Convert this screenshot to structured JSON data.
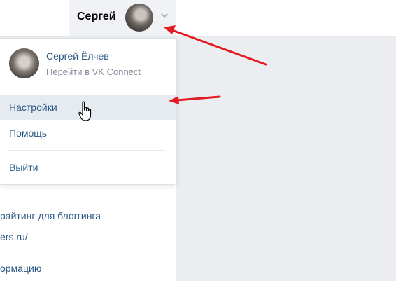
{
  "header": {
    "user_short_name": "Сергей"
  },
  "dropdown": {
    "full_name": "Сергей Ёлчев",
    "subtitle": "Перейти в VK Connect",
    "items": [
      {
        "label": "Настройки"
      },
      {
        "label": "Помощь"
      },
      {
        "label": "Выйти"
      }
    ]
  },
  "background_content": {
    "lines": [
      "райтинг для блоггинга",
      "ers.ru/",
      "ормацию"
    ]
  },
  "colors": {
    "link": "#2a5885",
    "secondary_text": "#818c99",
    "active_item_bg": "#e5ebf1",
    "annotation_arrow": "#e31b23"
  },
  "icons": {
    "chevron": "chevron-down-icon",
    "cursor": "hand-pointer-icon"
  }
}
